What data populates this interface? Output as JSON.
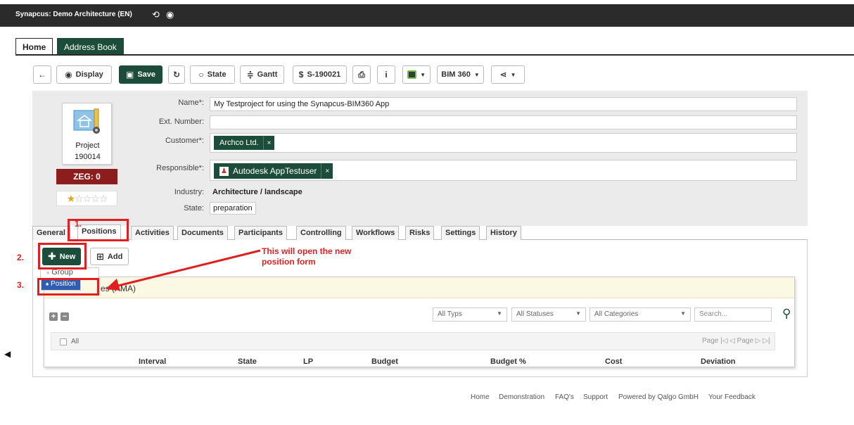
{
  "app": {
    "title": "Synapcus: Demo Architecture (EN)",
    "icons": [
      "history-icon",
      "eye-icon"
    ]
  },
  "main_tabs": [
    {
      "label": "Home",
      "active": true
    },
    {
      "label": "Address Book",
      "active": false
    }
  ],
  "toolbar": {
    "back_icon": "arrow-left-icon",
    "display_label": "Display",
    "save_label": "Save",
    "state_label": "State",
    "gantt_label": "Gantt",
    "project_code": "S-190021",
    "bim_label": "BIM 360"
  },
  "project": {
    "type_label": "Project",
    "number": "190014",
    "zeg_label": "ZEG: 0",
    "rating": 1,
    "rating_max": 5
  },
  "form": {
    "name_label": "Name*:",
    "name_value": "My Testproject for using the Synapcus-BIM360 App",
    "ext_label": "Ext. Number:",
    "ext_value": "",
    "customer_label": "Customer*:",
    "customer_value": "Archco Ltd.",
    "responsible_label": "Responsible*:",
    "responsible_value": "Autodesk AppTestuser",
    "industry_label": "Industry:",
    "industry_value": "Architecture / landscape",
    "state_label": "State:",
    "state_value": "preparation",
    "chip_remove": "×"
  },
  "sub_tabs": [
    {
      "label": "General",
      "active": false
    },
    {
      "label": "Positions",
      "active": true
    },
    {
      "label": "Activities",
      "active": false
    },
    {
      "label": "Documents",
      "active": false
    },
    {
      "label": "Participants",
      "active": false
    },
    {
      "label": "Controlling",
      "active": false
    },
    {
      "label": "Workflows",
      "active": false
    },
    {
      "label": "Risks",
      "active": false
    },
    {
      "label": "Settings",
      "active": false
    },
    {
      "label": "History",
      "active": false
    }
  ],
  "positions": {
    "new_label": "New",
    "add_label": "Add",
    "menu": [
      "Group",
      "Position"
    ],
    "header_fragment": "es (AMA)",
    "filters": [
      "All Typs",
      "All Statuses",
      "All Categories"
    ],
    "search_placeholder": "Search...",
    "all_label": "All",
    "pager": "Page |◁ ◁ Page ▷ ▷|",
    "columns": [
      "Interval",
      "State",
      "LP",
      "Budget",
      "Budget %",
      "Cost",
      "Deviation"
    ]
  },
  "annotations": {
    "n1": "1.",
    "n2": "2.",
    "n3": "3.",
    "callout": "This will open the new\nposition form"
  },
  "footer": [
    "Home",
    "Demonstration",
    "FAQ's",
    "Support",
    "Powered by Qalgo GmbH",
    "Your Feedback"
  ],
  "colors": {
    "brand_green": "#1c4d3b",
    "top_bar": "#2b2b2b",
    "zeg_red": "#8c1d1d",
    "annotation_red": "#e02020",
    "menu_selected": "#2e5db3"
  }
}
